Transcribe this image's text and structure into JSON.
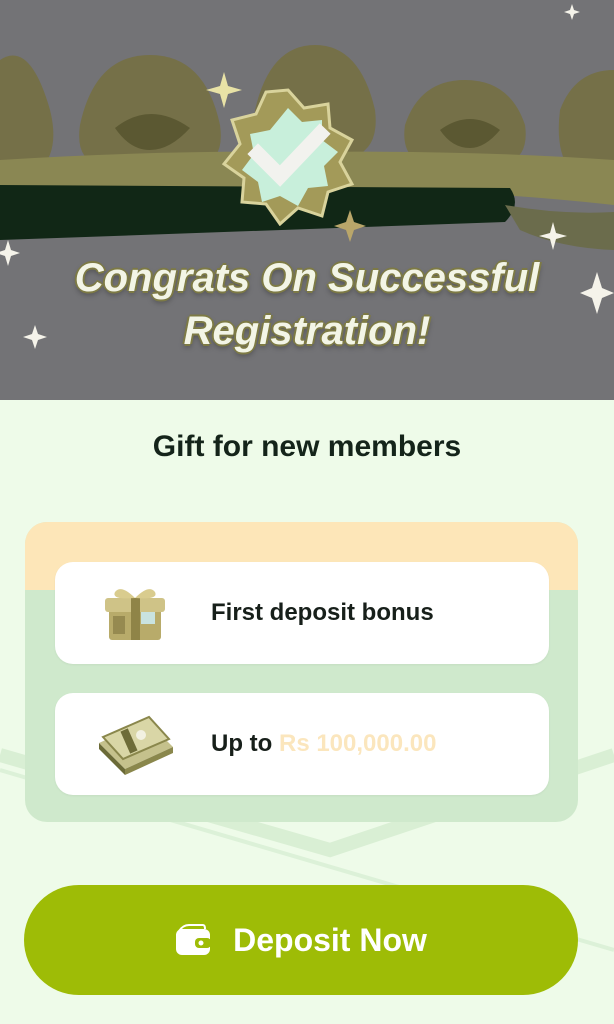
{
  "hero": {
    "title_line1": "Congrats On Successful",
    "title_line2": "Registration!",
    "badge_icon": "checkmark-badge-icon"
  },
  "gift": {
    "heading": "Gift for new members"
  },
  "cards": [
    {
      "icon": "gift-box-icon",
      "label": "First deposit bonus"
    },
    {
      "icon": "cash-stack-icon",
      "label_prefix": "Up to",
      "amount": "Rs 100,000.00"
    }
  ],
  "deposit": {
    "icon": "wallet-icon",
    "label": "Deposit Now"
  },
  "colors": {
    "accent": "#9ebc06",
    "amount_text": "#fbe6bd",
    "page_bg": "#eefbe9",
    "panel_top": "#fde6b8"
  }
}
